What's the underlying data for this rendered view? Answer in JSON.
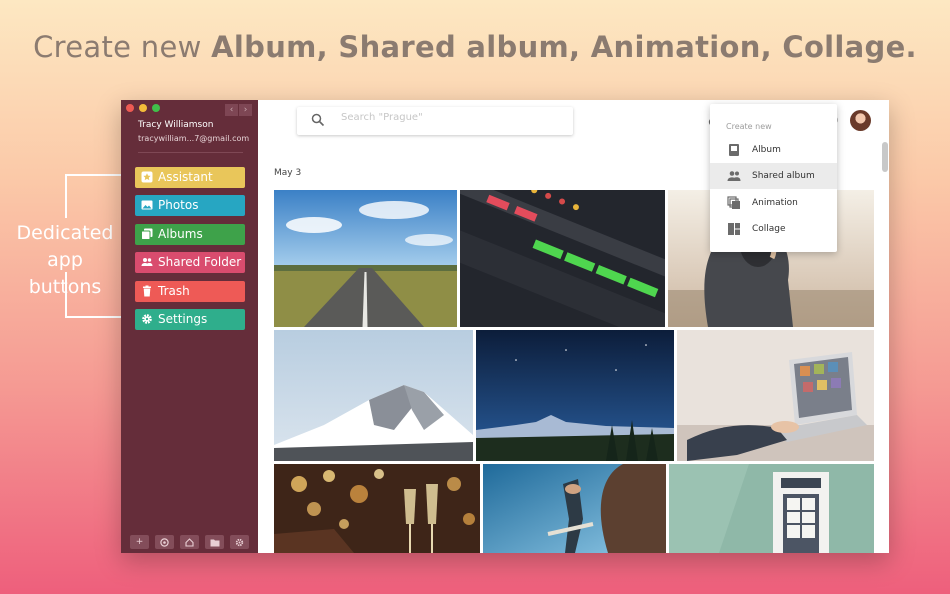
{
  "headline": {
    "prefix": "Create new ",
    "bold": "Album, Shared album, Animation, Collage."
  },
  "callout": {
    "line1": "Dedicated",
    "line2": "app buttons"
  },
  "sidebar": {
    "user_name": "Tracy Williamson",
    "user_email": "tracywilliam...7@gmail.com",
    "nav_back": "‹",
    "nav_forward": "›",
    "apps": [
      {
        "label": "Assistant",
        "color": "#e9c65a",
        "icon": "star-icon"
      },
      {
        "label": "Photos",
        "color": "#27a6c2",
        "icon": "image-icon"
      },
      {
        "label": "Albums",
        "color": "#3ea24a",
        "icon": "albums-icon"
      },
      {
        "label": "Shared Folder",
        "color": "#d94c6e",
        "icon": "people-icon"
      },
      {
        "label": "Trash",
        "color": "#ee5a56",
        "icon": "trash-icon"
      },
      {
        "label": "Settings",
        "color": "#2fae8c",
        "icon": "gear-icon"
      }
    ],
    "bottom_icons": [
      "add-icon",
      "help-icon",
      "home-icon",
      "folder-icon",
      "settings-icon"
    ]
  },
  "toolbar": {
    "search_placeholder": "Search \"Prague\""
  },
  "content": {
    "date_label": "May 3"
  },
  "dropdown": {
    "title": "Create new",
    "items": [
      {
        "label": "Album",
        "icon": "album-icon"
      },
      {
        "label": "Shared album",
        "icon": "shared-album-icon",
        "active": true
      },
      {
        "label": "Animation",
        "icon": "animation-icon"
      },
      {
        "label": "Collage",
        "icon": "collage-icon"
      }
    ]
  },
  "photos": [
    "road",
    "mixing-console",
    "hooded-person",
    "snowy-mountain",
    "night-sky-mountains",
    "laptop",
    "bokeh-champagne",
    "skateboarder",
    "door"
  ]
}
